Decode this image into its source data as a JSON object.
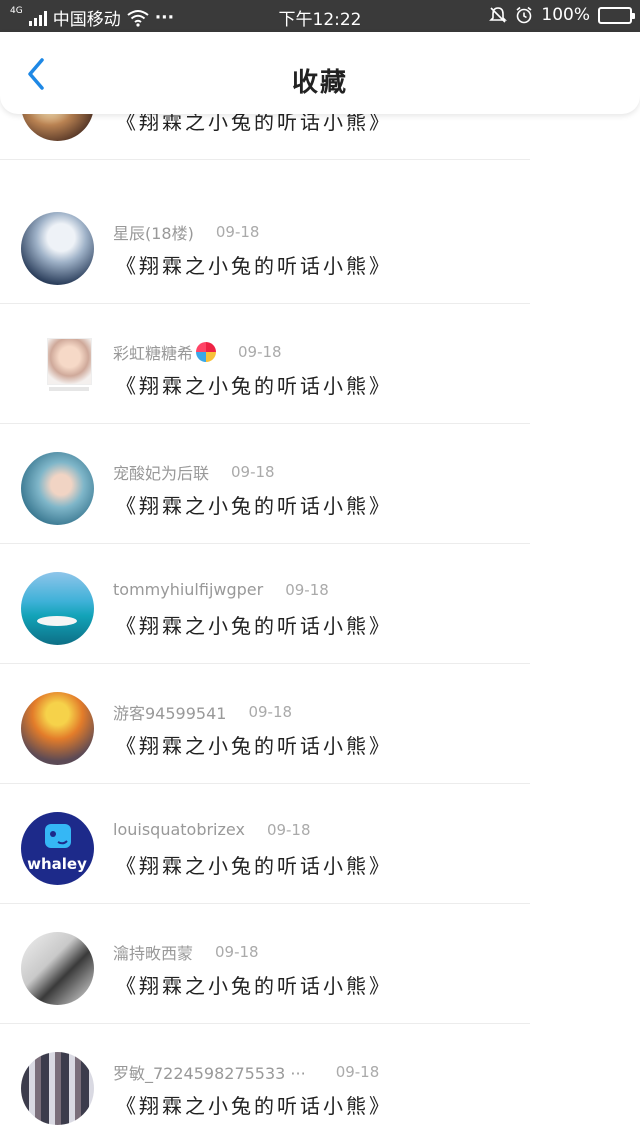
{
  "status_bar": {
    "network": "4G",
    "carrier": "中国移动",
    "more": "···",
    "time": "下午12:22",
    "battery": "100%",
    "battery_level": 1.0,
    "icons": [
      "signal-icon",
      "wifi-icon",
      "mute-icon",
      "alarm-icon",
      "battery-icon"
    ]
  },
  "header": {
    "back_icon": "chevron-left-icon",
    "title": "收藏",
    "accent": "#1e88e5"
  },
  "items": [
    {
      "name": "",
      "date": "",
      "message": "《翔霖之小兔的听话小熊》",
      "avatar": "anime-girl"
    },
    {
      "name": "星辰(18楼)",
      "date": "09-18",
      "message": "《翔霖之小兔的听话小熊》",
      "avatar": "anime-boy-white-hair"
    },
    {
      "name": "彩虹糖糖希",
      "date": "09-18",
      "message": "《翔霖之小兔的听话小熊》",
      "avatar": "photo-card",
      "emoji": "lollipop"
    },
    {
      "name": "宠酸妃为后联",
      "date": "09-18",
      "message": "《翔霖之小兔的听话小熊》",
      "avatar": "girl-sky"
    },
    {
      "name": "tommyhiulfijwgper",
      "date": "09-18",
      "message": "《翔霖之小兔的听话小熊》",
      "avatar": "boat-sea"
    },
    {
      "name": "游客94599541",
      "date": "09-18",
      "message": "《翔霖之小兔的听话小熊》",
      "avatar": "cartoon-character"
    },
    {
      "name": "louisquatobrizex",
      "date": "09-18",
      "message": "《翔霖之小兔的听话小熊》",
      "avatar": "whale-logo",
      "avatar_text": "whaley"
    },
    {
      "name": "瀹持畋西蒙",
      "date": "09-18",
      "message": "《翔霖之小兔的听话小熊》",
      "avatar": "ink-painting"
    },
    {
      "name": "罗敏_7224598275533 ···",
      "date": "09-18",
      "message": "《翔霖之小兔的听话小熊》",
      "avatar": "group-photo"
    }
  ]
}
